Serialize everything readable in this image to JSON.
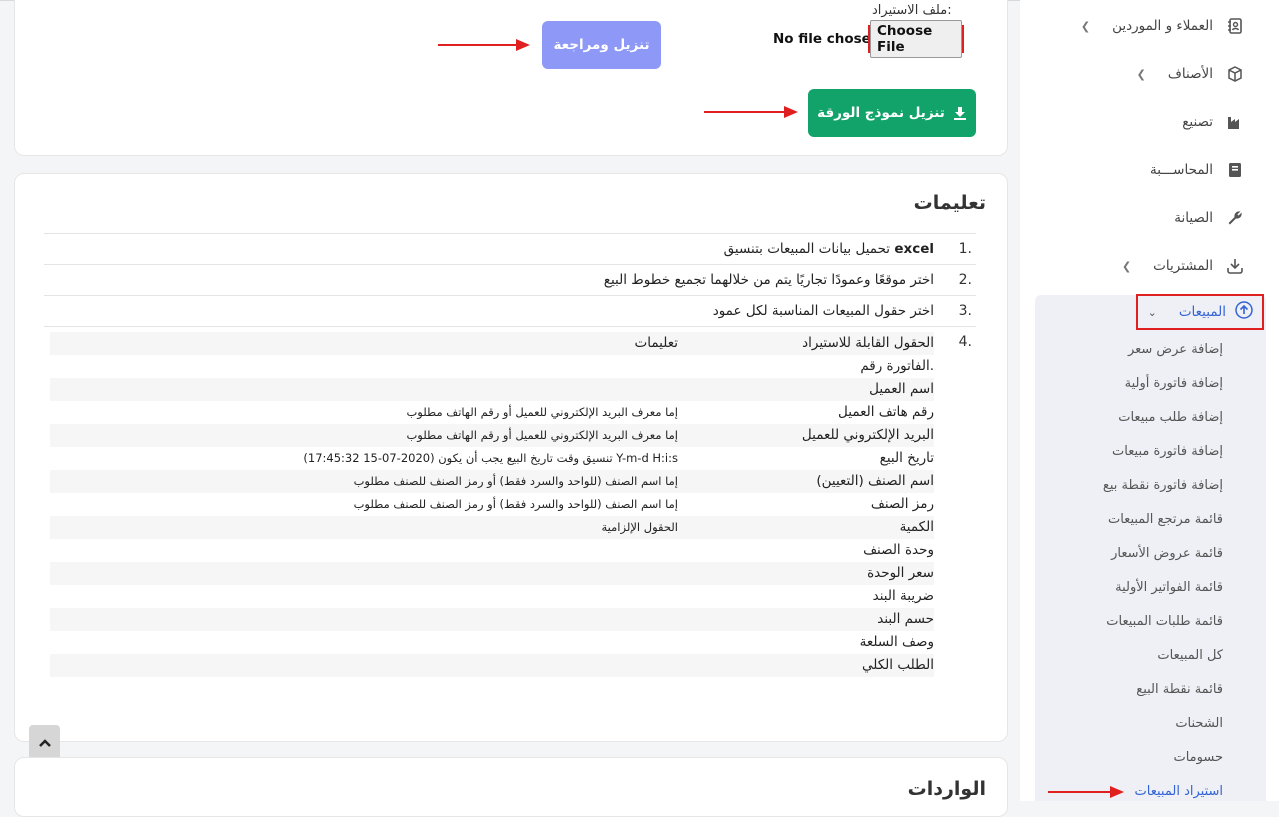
{
  "import_form": {
    "file_label": "ملف الاستيراد:",
    "no_file_text": "No file chosen",
    "choose_file_label": "Choose File",
    "review_button": "تنزيل ومراجعة",
    "template_button": "تنزيل نموذج الورقة"
  },
  "instructions": {
    "title": "تعليمات",
    "steps": [
      {
        "num": "1.",
        "text": "تحميل بيانات المبيعات بتنسيق ",
        "bold": "excel"
      },
      {
        "num": "2.",
        "text": "اختر موقعًا وعمودًا تجاريًا يتم من خلالهما تجميع خطوط البيع"
      },
      {
        "num": "3.",
        "text": "اختر حقول المبيعات المناسبة لكل عمود"
      },
      {
        "num": "4."
      }
    ],
    "table": {
      "header_field": "الحقول القابلة للاستيراد",
      "header_notes": "تعليمات",
      "rows": [
        {
          "field": "الفاتورة رقم.",
          "note": ""
        },
        {
          "field": "اسم العميل",
          "note": ""
        },
        {
          "field": "رقم هاتف العميل",
          "note": "إما معرف البريد الإلكتروني للعميل أو رقم الهاتف مطلوب"
        },
        {
          "field": "البريد الإلكتروني للعميل",
          "note": "إما معرف البريد الإلكتروني للعميل أو رقم الهاتف مطلوب"
        },
        {
          "field": "تاريخ البيع",
          "note": "تنسيق وقت تاريخ البيع يجب أن يكون (2020-07-15 17:45:32) Y-m-d H:i:s"
        },
        {
          "field": "اسم الصنف (التعيين)",
          "note": "إما اسم الصنف (للواحد والسرد فقط) أو رمز الصنف للصنف مطلوب"
        },
        {
          "field": "رمز الصنف",
          "note": "إما اسم الصنف (للواحد والسرد فقط) أو رمز الصنف للصنف مطلوب"
        },
        {
          "field": "الكمية",
          "note": "الحقول الإلزامية"
        },
        {
          "field": "وحدة الصنف",
          "note": ""
        },
        {
          "field": "سعر الوحدة",
          "note": ""
        },
        {
          "field": "ضريبة البند",
          "note": ""
        },
        {
          "field": "حسم البند",
          "note": ""
        },
        {
          "field": "وصف السلعة",
          "note": ""
        },
        {
          "field": "الطلب الكلي",
          "note": ""
        }
      ]
    }
  },
  "imports_section": {
    "title": "الواردات"
  },
  "sidebar": {
    "items": [
      {
        "label": "العملاء و الموردين",
        "icon": "contacts-book-icon",
        "chevron": true
      },
      {
        "label": "الأصناف",
        "icon": "box-icon",
        "chevron": true
      },
      {
        "label": "تصنيع",
        "icon": "factory-icon",
        "chevron": false
      },
      {
        "label": "المحاســـبة",
        "icon": "ledger-book-icon",
        "chevron": false
      },
      {
        "label": "الصيانة",
        "icon": "wrench-icon",
        "chevron": false
      },
      {
        "label": "المشتريات",
        "icon": "download-icon",
        "chevron": true
      }
    ],
    "sales": {
      "label": "المبيعات",
      "icon": "upload-icon"
    },
    "sales_submenu": [
      "إضافة عرض سعر",
      "إضافة فاتورة أولية",
      "إضافة طلب مبيعات",
      "إضافة فاتورة مبيعات",
      "إضافة فاتورة نقطة بيع",
      "قائمة مرتجع المبيعات",
      "قائمة عروض الأسعار",
      "قائمة الفواتير الأولية",
      "قائمة طلبات المبيعات",
      "كل المبيعات",
      "قائمة نقطة البيع",
      "الشحنات",
      "حسومات",
      "استيراد المبيعات"
    ]
  },
  "colors": {
    "accent_blue": "#3463d6",
    "review_button": "#8d98f7",
    "template_button": "#12a36b",
    "annotation_red": "#e02020"
  }
}
